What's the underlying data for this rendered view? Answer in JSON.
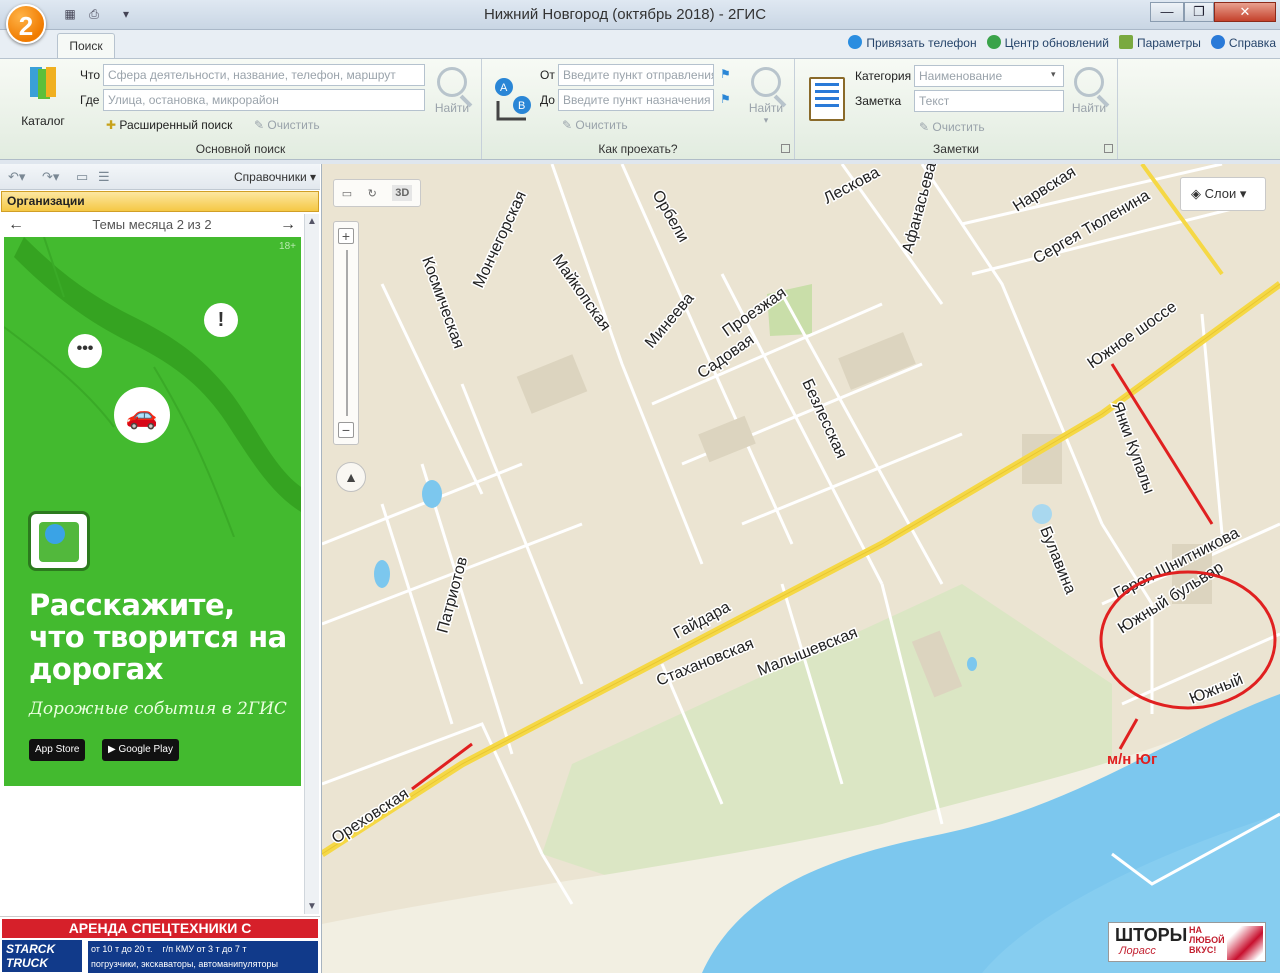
{
  "window": {
    "title": "Нижний Новгород (октябрь 2018) - 2ГИС",
    "logo": "2",
    "controls": [
      "—",
      "❐",
      "✕"
    ]
  },
  "tabs": {
    "active": "Поиск"
  },
  "toplinks": [
    {
      "label": "Привязать телефон",
      "icon": "phone-icon"
    },
    {
      "label": "Центр обновлений",
      "icon": "refresh-icon"
    },
    {
      "label": "Параметры",
      "icon": "settings-icon"
    },
    {
      "label": "Справка",
      "icon": "help-icon"
    }
  ],
  "ribbon": {
    "search": {
      "catalog_label": "Каталог",
      "what_label": "Что",
      "what_placeholder": "Сфера деятельности, название, телефон, маршрут",
      "where_label": "Где",
      "where_placeholder": "Улица, остановка, микрорайон",
      "advanced_label": "Расширенный поиск",
      "clear_label": "Очистить",
      "find_label": "Найти",
      "group_label": "Основной поиск"
    },
    "route": {
      "from_label": "От",
      "from_placeholder": "Введите пункт отправления",
      "to_label": "До",
      "to_placeholder": "Введите пункт назначения",
      "clear_label": "Очистить",
      "find_label": "Найти",
      "group_label": "Как проехать?"
    },
    "notes": {
      "category_label": "Категория",
      "category_value": "Наименование",
      "note_label": "Заметка",
      "note_placeholder": "Текст",
      "clear_label": "Очистить",
      "find_label": "Найти",
      "group_label": "Заметки"
    }
  },
  "sidebar": {
    "directory_label": "Справочники",
    "section": "Организации",
    "theme_label": "Темы месяца 2 из 2",
    "promo": {
      "age": "18+",
      "headline": "Расскажите, что творится на дорогах",
      "subline": "Дорожные события в 2ГИС",
      "app_store": "App Store",
      "google_play": "Google Play"
    },
    "banner": {
      "heading": "АРЕНДА СПЕЦТЕХНИКИ С РОСТЕХНАДЗОРОМ",
      "brand": "STARCK TRUCK",
      "text_line1": "от 10 т до 20 т.    г/п КМУ от 3 т до 7 т",
      "text_line2": "погрузчики, экскаваторы, автоманипуляторы"
    }
  },
  "map": {
    "tools": [
      "ruler-icon",
      "rotate-icon",
      "3D"
    ],
    "layers_label": "Слои",
    "streets": [
      "Мончегорская",
      "Майкопская",
      "Орбели",
      "Лескова",
      "Афанасьева",
      "Нарвская",
      "Сергея Тюленина",
      "Космическая",
      "Минеева",
      "Проезжая",
      "Садовая",
      "Безлесская",
      "Южное шоссе",
      "Янки Купалы",
      "Героя Шнитникова",
      "Южный бульвар",
      "Южный",
      "Булавина",
      "Гайдара",
      "Стахановская",
      "Малышевская",
      "Патриотов",
      "Ореховская"
    ],
    "annotation": "м/н Юг",
    "colors": {
      "annotation": "#e02020",
      "water": "#7cc7ee",
      "green": "#cfe3b0",
      "highway": "#f5d845"
    }
  },
  "ad_corner": {
    "brand": "ШТОРЫ",
    "tagline": "НА ЛЮБОЙ ВКУС!",
    "script": "Лорасс"
  }
}
